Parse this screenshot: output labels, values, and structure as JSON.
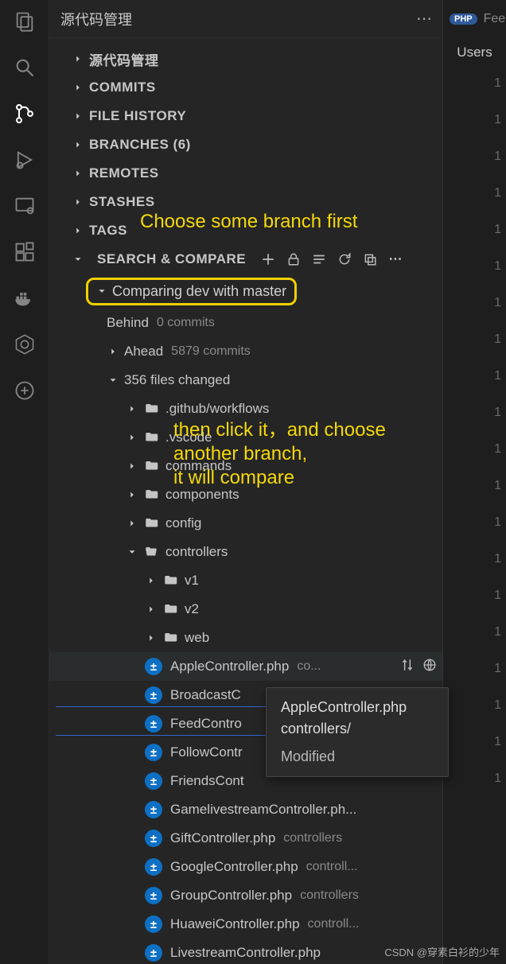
{
  "header": {
    "title": "源代码管理"
  },
  "activity": {
    "items": [
      "files",
      "search",
      "scm",
      "debug",
      "remote",
      "extensions",
      "docker",
      "kubernetes",
      "other"
    ]
  },
  "sections": {
    "scm": "源代码管理",
    "commits": "COMMITS",
    "file_history": "FILE HISTORY",
    "branches": "BRANCHES (6)",
    "remotes": "REMOTES",
    "stashes": "STASHES",
    "tags": "TAGS",
    "search_compare": "SEARCH & COMPARE"
  },
  "compare": {
    "title": "Comparing dev with master",
    "behind_label": "Behind",
    "behind_value": "0 commits",
    "ahead_label": "Ahead",
    "ahead_value": "5879 commits",
    "files_changed": "356 files changed",
    "folders": [
      ".github/workflows",
      ".vscode",
      "commands",
      "components",
      "config"
    ],
    "controllers_label": "controllers",
    "subfolders": [
      "v1",
      "v2",
      "web"
    ],
    "files": [
      {
        "name": "AppleController.php",
        "dir": "co..."
      },
      {
        "name": "BroadcastC",
        "dir": ""
      },
      {
        "name": "FeedContro",
        "dir": ""
      },
      {
        "name": "FollowContr",
        "dir": ""
      },
      {
        "name": "FriendsCont",
        "dir": ""
      },
      {
        "name": "GamelivestreamController.ph...",
        "dir": ""
      },
      {
        "name": "GiftController.php",
        "dir": "controllers"
      },
      {
        "name": "GoogleController.php",
        "dir": "controll..."
      },
      {
        "name": "GroupController.php",
        "dir": "controllers"
      },
      {
        "name": "HuaweiController.php",
        "dir": "controll..."
      },
      {
        "name": "LivestreamController.php",
        "dir": ""
      }
    ]
  },
  "annotations": {
    "a1": "Choose some branch first",
    "a2": "then click it，and choose\nanother branch,\nit will compare"
  },
  "tooltip": {
    "file": "AppleController.php",
    "dir": "controllers/",
    "status": "Modified"
  },
  "editor": {
    "tab_lang": "PHP",
    "tab_text": "Fee",
    "crumb": "Users"
  },
  "watermark": "CSDN @穿素白衫的少年"
}
